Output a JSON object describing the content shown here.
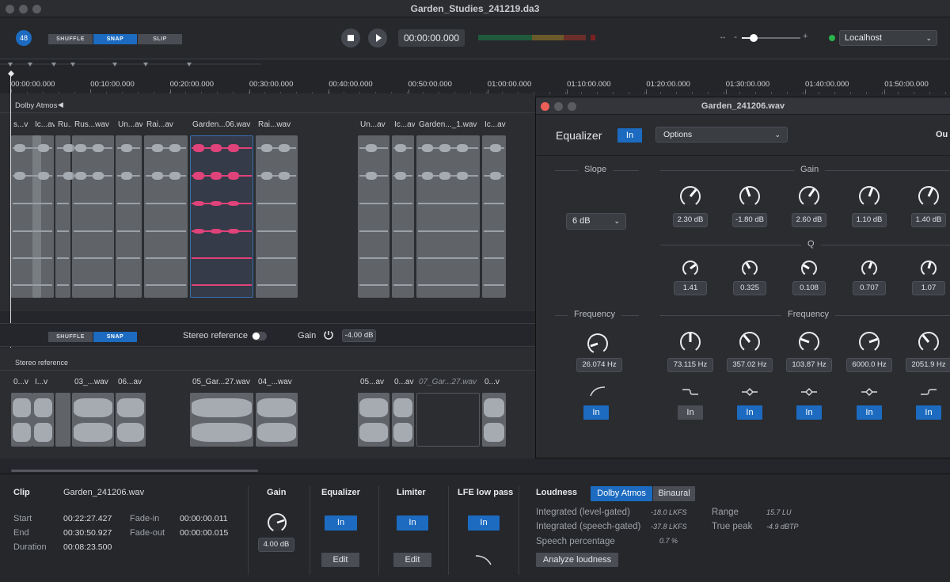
{
  "window": {
    "title": "Garden_Studies_241219.da3"
  },
  "toolbar": {
    "badge": "48",
    "modes": [
      "SHUFFLE",
      "SNAP",
      "SLIP"
    ],
    "active_mode": "SNAP",
    "timecode": "00:00:00.000",
    "zoom_minus": "-",
    "zoom_plus": "+",
    "zoom_level": 0.2,
    "output": "Localhost"
  },
  "ruler": {
    "ticks": [
      "00:00:00.000",
      "00:10:00.000",
      "00:20:00.000",
      "00:30:00.000",
      "00:40:00.000",
      "00:50:00.000",
      "01:00:00.000",
      "01:10:00.000",
      "01:20:00.000",
      "01:30:00.000",
      "01:40:00.000",
      "01:50:00.000"
    ]
  },
  "atmos_track": {
    "name": "Dolby Atmos",
    "clips": [
      "s...v",
      "Ic...av",
      "Ru...",
      "Rus...wav",
      "Un...av",
      "Rai...av",
      "Garden...06.wav",
      "Rai...wav",
      "Un...av",
      "Ic...av",
      "Garden..._1.wav",
      "Ic...av"
    ]
  },
  "stereo_bar": {
    "modes": [
      "SHUFFLE",
      "SNAP"
    ],
    "stereo_reference_label": "Stereo reference",
    "gain_label": "Gain",
    "gain_value": "-4.00 dB"
  },
  "stereo_track": {
    "name": "Stereo reference",
    "clips": [
      "0...v",
      "I...v",
      "03_...wav",
      "06...av",
      "05_Gar...27.wav",
      "04_...wav",
      "05...av",
      "0...av",
      "07_Gar...27.wav",
      "0...v"
    ]
  },
  "clip_panel": {
    "clip_label": "Clip",
    "clip_name": "Garden_241206.wav",
    "start_label": "Start",
    "start": "00:22:27.427",
    "end_label": "End",
    "end": "00:30:50.927",
    "duration_label": "Duration",
    "duration": "00:08:23.500",
    "fadein_label": "Fade-in",
    "fadein": "00:00:00.011",
    "fadeout_label": "Fade-out",
    "fadeout": "00:00:00.015"
  },
  "gain_panel": {
    "title": "Gain",
    "value": "4.00 dB"
  },
  "equalizer_panel": {
    "title": "Equalizer",
    "in": "In",
    "edit": "Edit"
  },
  "limiter_panel": {
    "title": "Limiter",
    "in": "In",
    "edit": "Edit"
  },
  "lfe_panel": {
    "title": "LFE low pass",
    "in": "In"
  },
  "loudness": {
    "title": "Loudness",
    "tabs": [
      "Dolby Atmos",
      "Binaural"
    ],
    "active_tab": "Dolby Atmos",
    "integrated_level": {
      "label": "Integrated (level-gated)",
      "value": "-18.0 LKFS"
    },
    "integrated_speech": {
      "label": "Integrated (speech-gated)",
      "value": "-37.8 LKFS"
    },
    "speech_percentage": {
      "label": "Speech percentage",
      "value": "0.7 %"
    },
    "range": {
      "label": "Range",
      "value": "15.7 LU"
    },
    "true_peak": {
      "label": "True peak",
      "value": "-4.9 dBTP"
    },
    "analyze": "Analyze loudness"
  },
  "eq_window": {
    "title": "Garden_241206.wav",
    "eq_label": "Equalizer",
    "in": "In",
    "options": "Options",
    "out_label": "Ou",
    "slope_label": "Slope",
    "slope_value": "6 dB",
    "gain_label": "Gain",
    "q_label": "Q",
    "frequency_label": "Frequency",
    "low_frequency": "26.074 Hz",
    "gains": [
      "2.30 dB",
      "-1.80 dB",
      "2.60 dB",
      "1.10 dB",
      "1.40 dB"
    ],
    "qs": [
      "1.41",
      "0.325",
      "0.108",
      "0.707",
      "1.07"
    ],
    "frequencies": [
      "73.115 Hz",
      "357.02 Hz",
      "103.87 Hz",
      "6000.0 Hz",
      "2051.9 Hz"
    ],
    "band_buttons": [
      "In",
      "In",
      "In",
      "In",
      "In",
      "In"
    ],
    "band_states": [
      true,
      false,
      true,
      true,
      true,
      true
    ]
  },
  "colors": {
    "accent": "#1c6bc0",
    "selected_wave": "#e0427a",
    "bg": "#24262b"
  }
}
